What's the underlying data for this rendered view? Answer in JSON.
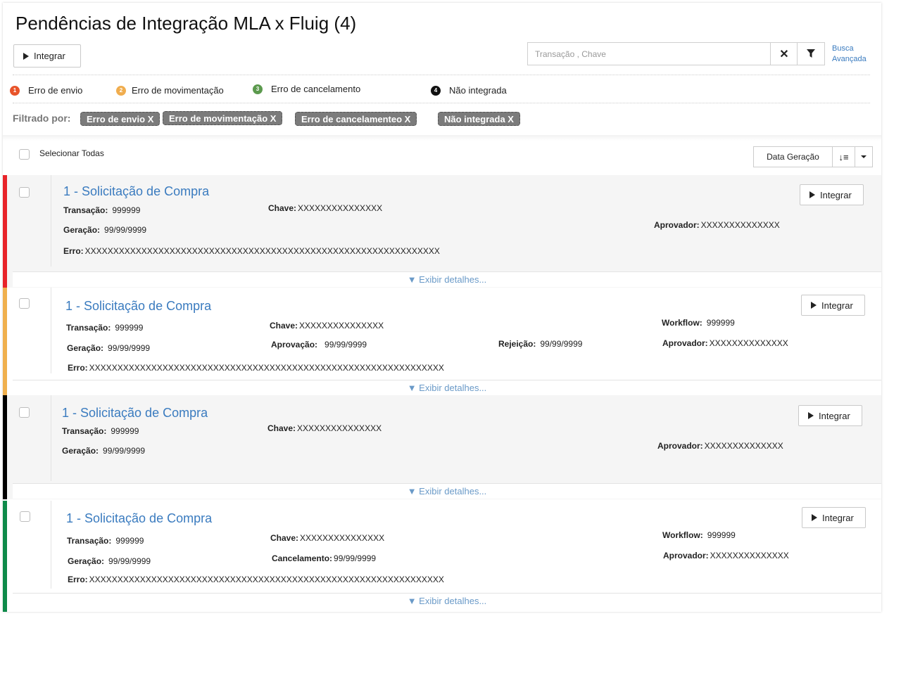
{
  "header": {
    "title": "Pendências de Integração MLA x Fluig",
    "count": "(4)",
    "integrar_label": "Integrar",
    "search_placeholder": "Transação , Chave",
    "advanced_line1": "Busca",
    "advanced_line2": "Avançada"
  },
  "legend": [
    {
      "num": "1",
      "label": "Erro de envio",
      "color": "#e8542a"
    },
    {
      "num": "2",
      "label": "Erro de movimentação",
      "color": "#f0ad4e"
    },
    {
      "num": "3",
      "label": "Erro de cancelamento",
      "color": "#5c9a4e"
    },
    {
      "num": "4",
      "label": "Não integrada",
      "color": "#111111"
    }
  ],
  "filters": {
    "label": "Filtrado por:",
    "chips": [
      "Erro de envio X",
      "Erro de movimentação X",
      "Erro de cancelamenteo X",
      "Não integrada X"
    ]
  },
  "list": {
    "select_all": "Selecionar Todas",
    "sort_label": "Data Geração"
  },
  "cards": [
    {
      "color": "#e8242a",
      "title": "1 - Solicitação de Compra",
      "integrar": "Integrar",
      "transacao_label": "Transação:",
      "transacao": "999999",
      "geracao_label": "Geração:",
      "geracao": "99/99/9999",
      "chave_label": "Chave:",
      "chave": "XXXXXXXXXXXXXXX",
      "aprovador_label": "Aprovador:",
      "aprovador": "XXXXXXXXXXXXXX",
      "erro_label": "Erro:",
      "erro": "XXXXXXXXXXXXXXXXXXXXXXXXXXXXXXXXXXXXXXXXXXXXXXXXXXXXXXXXXXXXXXX",
      "details": "▼ Exibir detalhes..."
    },
    {
      "color": "#f0b04e",
      "title": "1 - Solicitação de Compra",
      "integrar": "Integrar",
      "transacao_label": "Transação:",
      "transacao": "999999",
      "geracao_label": "Geração:",
      "geracao": "99/99/9999",
      "chave_label": "Chave:",
      "chave": "XXXXXXXXXXXXXXX",
      "aprovacao_label": "Aprovação:",
      "aprovacao": "99/99/9999",
      "rejeicao_label": "Rejeição:",
      "rejeicao": "99/99/9999",
      "workflow_label": "Workflow:",
      "workflow": "999999",
      "aprovador_label": "Aprovador:",
      "aprovador": "XXXXXXXXXXXXXX",
      "erro_label": "Erro:",
      "erro": "XXXXXXXXXXXXXXXXXXXXXXXXXXXXXXXXXXXXXXXXXXXXXXXXXXXXXXXXXXXXXXX",
      "details": "▼ Exibir detalhes..."
    },
    {
      "color": "#000000",
      "title": "1 - Solicitação de Compra",
      "integrar": "Integrar",
      "transacao_label": "Transação:",
      "transacao": "999999",
      "geracao_label": "Geração:",
      "geracao": "99/99/9999",
      "chave_label": "Chave:",
      "chave": "XXXXXXXXXXXXXXX",
      "aprovador_label": "Aprovador:",
      "aprovador": "XXXXXXXXXXXXXX",
      "details": "▼ Exibir detalhes..."
    },
    {
      "color": "#0e8a4a",
      "title": "1 - Solicitação de Compra",
      "integrar": "Integrar",
      "transacao_label": "Transação:",
      "transacao": "999999",
      "geracao_label": "Geração:",
      "geracao": "99/99/9999",
      "chave_label": "Chave:",
      "chave": "XXXXXXXXXXXXXXX",
      "cancelamento_label": "Cancelamento:",
      "cancelamento": "99/99/9999",
      "workflow_label": "Workflow:",
      "workflow": "999999",
      "aprovador_label": "Aprovador:",
      "aprovador": "XXXXXXXXXXXXXX",
      "erro_label": "Erro:",
      "erro": "XXXXXXXXXXXXXXXXXXXXXXXXXXXXXXXXXXXXXXXXXXXXXXXXXXXXXXXXXXXXXXX",
      "details": "▼ Exibir detalhes..."
    }
  ]
}
